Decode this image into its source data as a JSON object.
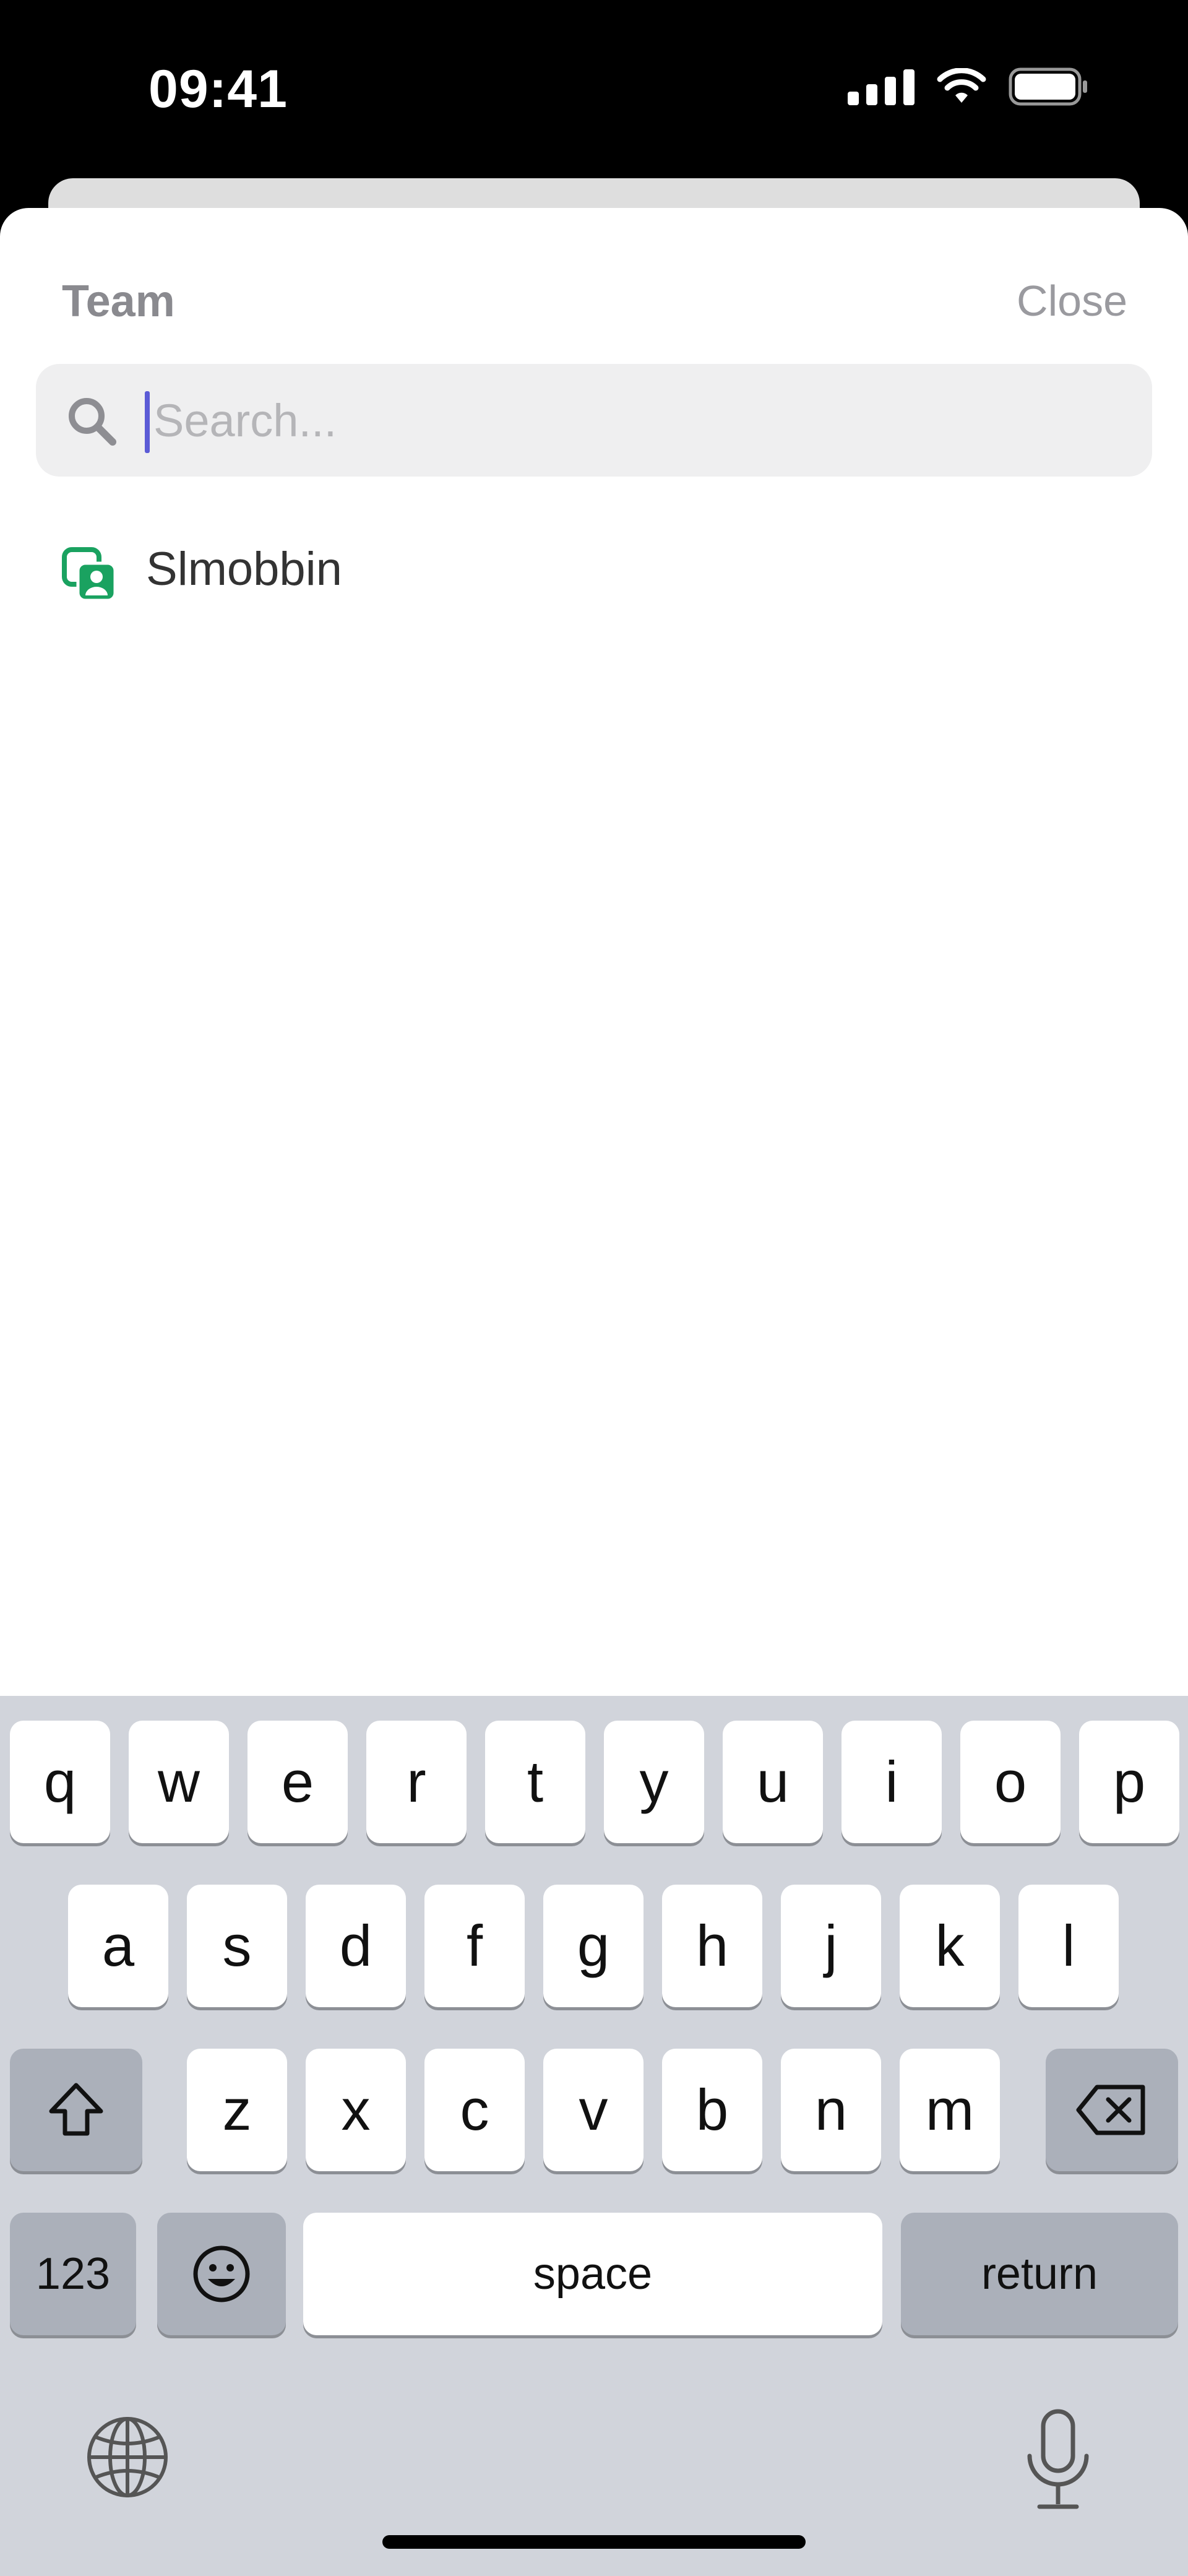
{
  "status_bar": {
    "time": "09:41"
  },
  "sheet": {
    "title": "Team",
    "close_label": "Close",
    "search": {
      "placeholder": "Search...",
      "value": ""
    }
  },
  "teams": [
    {
      "name": "Slmobbin"
    }
  ],
  "keyboard": {
    "row1": [
      "q",
      "w",
      "e",
      "r",
      "t",
      "y",
      "u",
      "i",
      "o",
      "p"
    ],
    "row2": [
      "a",
      "s",
      "d",
      "f",
      "g",
      "h",
      "j",
      "k",
      "l"
    ],
    "row3": [
      "z",
      "x",
      "c",
      "v",
      "b",
      "n",
      "m"
    ],
    "numbers_label": "123",
    "space_label": "space",
    "return_label": "return"
  },
  "colors": {
    "accent": "#5b5bd6",
    "team_icon": "#1aa260"
  }
}
